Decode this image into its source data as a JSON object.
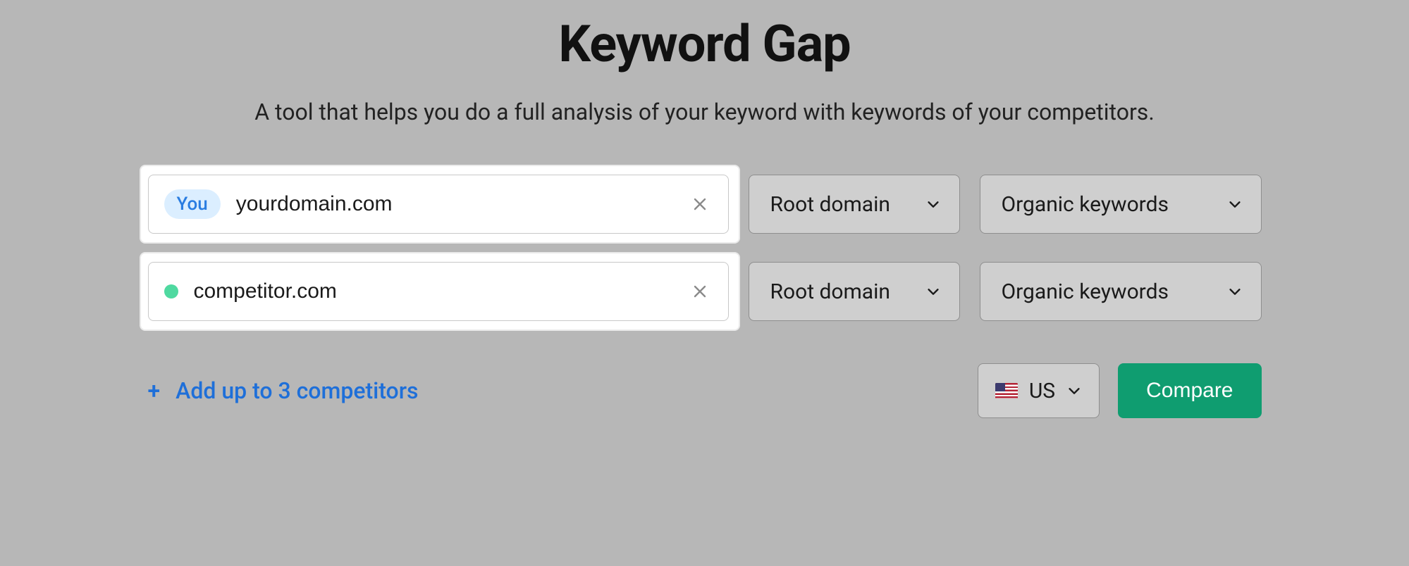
{
  "title": "Keyword Gap",
  "subtitle": "A tool that helps you do a full analysis of your keyword with keywords of your competitors.",
  "rows": [
    {
      "badge": "You",
      "domain": "yourdomain.com",
      "domain_type": "Root domain",
      "keyword_type": "Organic keywords",
      "dot_color": null
    },
    {
      "badge": null,
      "domain": "competitor.com",
      "domain_type": "Root domain",
      "keyword_type": "Organic keywords",
      "dot_color": "#4fd9a0"
    }
  ],
  "add_competitors_label": "Add up to 3 competitors",
  "country": {
    "code": "US",
    "label": "US"
  },
  "compare_label": "Compare"
}
